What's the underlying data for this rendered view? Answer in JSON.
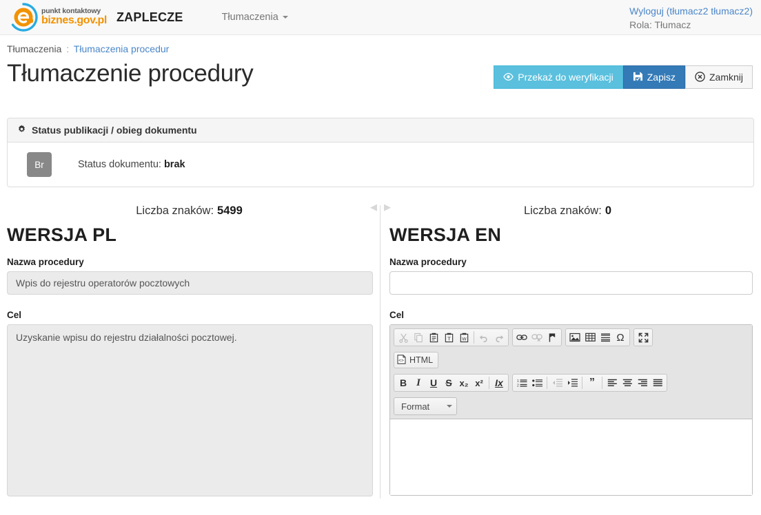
{
  "navbar": {
    "logo_top": "punkt kontaktowy",
    "logo_bottom": "biznes.gov.pl",
    "logo_letter": "e",
    "app_name": "ZAPLECZE",
    "menu": [
      {
        "label": "Tłumaczenia",
        "has_caret": true
      }
    ],
    "logout_link": "Wyloguj",
    "logout_user": "(tłumacz2 tłumacz2)",
    "role": "Rola: Tłumacz"
  },
  "breadcrumb": {
    "root": "Tłumaczenia",
    "separator": ":",
    "current": "Tłumaczenia procedur"
  },
  "page": {
    "title": "Tłumaczenie procedury"
  },
  "actions": {
    "verify": "Przekaż do weryfikacji",
    "save": "Zapisz",
    "close": "Zamknij",
    "verify_color": "#5bc0de",
    "save_color": "#337ab7",
    "close_color": "#f7f7f7"
  },
  "status_panel": {
    "heading": "Status publikacji / obieg dokumentu",
    "badge": "Br",
    "badge_color": "#888888",
    "label": "Status dokumentu:",
    "value": "brak"
  },
  "counters": {
    "pl_label": "Liczba znaków:",
    "pl_value": "5499",
    "en_label": "Liczba znaków:",
    "en_value": "0",
    "arrow_left": "◀",
    "arrow_right": "▶"
  },
  "columns": {
    "pl": {
      "heading": "WERSJA PL",
      "name_label": "Nazwa procedury",
      "name_value": "Wpis do rejestru operatorów pocztowych",
      "goal_label": "Cel",
      "goal_value": "Uzyskanie wpisu do rejestru działalności pocztowej."
    },
    "en": {
      "heading": "WERSJA EN",
      "name_label": "Nazwa procedury",
      "name_value": "",
      "name_placeholder": "",
      "goal_label": "Cel",
      "goal_value": ""
    }
  },
  "editor": {
    "groups": [
      {
        "name": "clipboard",
        "buttons": [
          {
            "name": "cut-icon",
            "title": "Wytnij",
            "disabled": true
          },
          {
            "name": "copy-icon",
            "title": "Kopiuj",
            "disabled": true
          },
          {
            "name": "paste-icon",
            "title": "Wklej",
            "disabled": false
          },
          {
            "name": "paste-text-icon",
            "title": "Wklej jako czysty tekst",
            "disabled": false
          },
          {
            "name": "paste-word-icon",
            "title": "Wklej z Worda",
            "disabled": false
          },
          {
            "name": "undo-icon",
            "title": "Cofnij",
            "disabled": true
          },
          {
            "name": "redo-icon",
            "title": "Ponów",
            "disabled": true
          }
        ]
      },
      {
        "name": "links",
        "buttons": [
          {
            "name": "link-icon",
            "title": "Wstaw odnośnik",
            "disabled": false
          },
          {
            "name": "unlink-icon",
            "title": "Usuń odnośnik",
            "disabled": true
          },
          {
            "name": "anchor-icon",
            "title": "Kotwica",
            "disabled": false
          }
        ]
      },
      {
        "name": "insert",
        "buttons": [
          {
            "name": "image-icon",
            "title": "Obrazek",
            "disabled": false
          },
          {
            "name": "table-icon",
            "title": "Tabela",
            "disabled": false
          },
          {
            "name": "horizontal-rule-icon",
            "title": "Linia pozioma",
            "disabled": false
          },
          {
            "name": "special-char-icon",
            "title": "Znak specjalny",
            "disabled": false
          }
        ]
      },
      {
        "name": "tools",
        "buttons": [
          {
            "name": "maximize-icon",
            "title": "Maksymalizuj",
            "disabled": false
          }
        ]
      }
    ],
    "source_button": "HTML",
    "basic_styles": [
      {
        "name": "bold-icon",
        "glyph": "B"
      },
      {
        "name": "italic-icon",
        "glyph": "I"
      },
      {
        "name": "underline-icon",
        "glyph": "U"
      },
      {
        "name": "strike-icon",
        "glyph": "S"
      },
      {
        "name": "subscript-icon",
        "glyph": "x₂"
      },
      {
        "name": "superscript-icon",
        "glyph": "x²"
      },
      {
        "name": "remove-format-icon",
        "glyph": "Ix"
      }
    ],
    "paragraph": [
      {
        "name": "numbered-list-icon",
        "disabled": false
      },
      {
        "name": "bulleted-list-icon",
        "disabled": false
      },
      {
        "name": "outdent-icon",
        "disabled": true
      },
      {
        "name": "indent-icon",
        "disabled": false
      },
      {
        "name": "blockquote-icon",
        "disabled": false
      },
      {
        "name": "align-left-icon",
        "disabled": false
      },
      {
        "name": "align-center-icon",
        "disabled": false
      },
      {
        "name": "align-right-icon",
        "disabled": false
      },
      {
        "name": "align-justify-icon",
        "disabled": false
      }
    ],
    "format_combo": "Format"
  }
}
